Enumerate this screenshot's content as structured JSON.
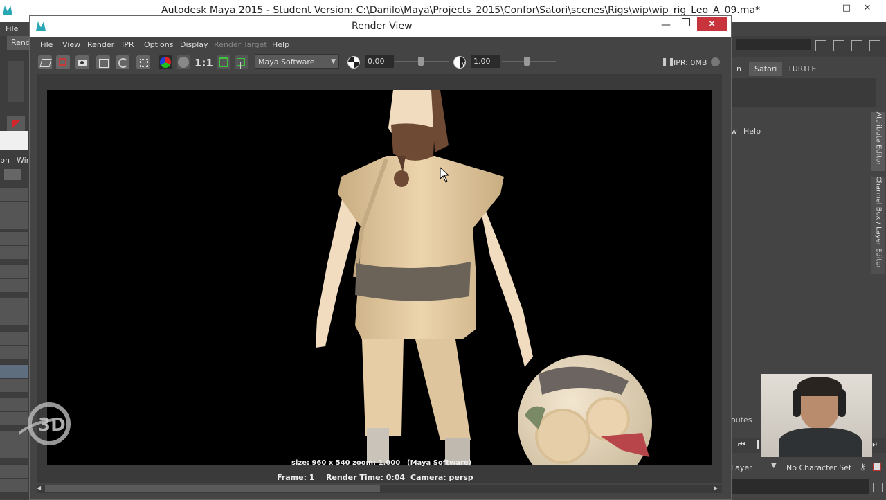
{
  "main_window": {
    "title": "Autodesk Maya 2015 - Student Version: C:\\Danilo\\Maya\\Projects_2015\\Confor\\Satori\\scenes\\Rigs\\wip\\wip_rig_Leo_A_09.ma*",
    "menu_file": "File",
    "left_menu_fragment_1": "Rend",
    "left_menu_fragment_2": "ph",
    "left_menu_fragment_3": "Win"
  },
  "right_panel": {
    "tab_fragment": "n",
    "tab_satori": "Satori",
    "tab_turtle": "TURTLE",
    "menu_fragment": "w",
    "menu_help": "Help",
    "vertical_tab_attribute_editor": "Attribute Editor",
    "vertical_tab_channel_box": "Channel Box / Layer Editor",
    "attributes_fragment": "outes",
    "layer_label": "Layer",
    "character_set": "No Character Set"
  },
  "render_view": {
    "title": "Render View",
    "menu": [
      "File",
      "View",
      "Render",
      "IPR",
      "Options",
      "Display",
      "Render Target",
      "Help"
    ],
    "menu_disabled": "Render Target",
    "toolbar": {
      "ratio_label": "1:1",
      "renderer": "Maya Software",
      "exposure_value": "0.00",
      "gamma_value": "1.00",
      "ipr_label": "IPR: 0MB"
    },
    "status": {
      "size": "size: 960 x 540  zoom: 1.000",
      "renderer": "(Maya Software)",
      "frame": "Frame: 1",
      "render_time": "Render Time: 0:04",
      "camera": "Camera: persp"
    },
    "viewport": {
      "exposure_level": 0.0,
      "gamma_level": 1.0
    }
  },
  "colors": {
    "maya_panel": "#444444",
    "viewport_bg": "#000000",
    "close_button": "#c7343b",
    "tunic": "#e3c79c",
    "belt": "#6b6258",
    "skin": "#f1dcc0",
    "beard": "#6e4a35"
  },
  "icons": [
    "render-icon",
    "render-region-icon",
    "snapshot-icon",
    "clapboard-icon",
    "refresh-ipr-icon",
    "camera-settings-icon",
    "rgb-channel-icon",
    "alpha-channel-icon",
    "real-size-icon",
    "render-region-toggle-icon",
    "keep-image-icon",
    "exposure-icon",
    "gamma-icon",
    "pause-icon",
    "ipr-status-icon"
  ]
}
